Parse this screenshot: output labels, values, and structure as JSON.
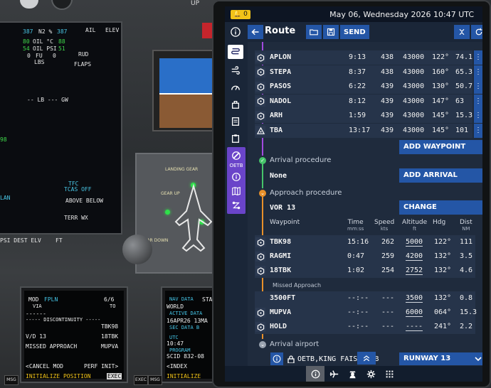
{
  "cockpit": {
    "up_label": "UP",
    "eicas": {
      "n2_left": "387",
      "n2_label": "N2 %",
      "n2_right": "387",
      "oil_temp_label": "OIL °C",
      "oil_temp_left": "80",
      "oil_temp_right": "88",
      "oil_psi_label": "OIL PSI",
      "oil_psi_left": "54",
      "oil_psi_right": "51",
      "fu_label": "FU",
      "fu_left": "0",
      "fu_right": "0",
      "lbs_label": "LBS",
      "ail_label": "AIL",
      "elev_label": "ELEV",
      "rud_label": "RUD",
      "flaps_label": "FLAPS",
      "lb_gw": "-- LB --- GW",
      "tfc": "TFC",
      "tcas_off": "TCAS OFF",
      "above_below": "ABOVE BELOW",
      "terr_wx": "TERR WX",
      "lan": "LAN",
      "psi_dest": "PSI DEST ELV",
      "ft": "FT",
      "num98": "98"
    },
    "gear_panel": {
      "title": "LANDING GEAR",
      "gear_up": "GEAR UP",
      "gear_down": "GEAR DOWN"
    },
    "cdu_left": {
      "line1a": "MOD",
      "line1b": "FPLN",
      "line1c": "6/6",
      "line2a": "VIA",
      "line2b": "TO",
      "line3": "------",
      "line4": "----- DISCONTINUITY -----",
      "line4b": "TBK98",
      "line5a": "V/D 13",
      "line5b": "18TBK",
      "line6a": "MISSED APPROACH",
      "line6b": "MUPVA",
      "line7a": "<CANCEL MOD",
      "line7b": "PERF INIT>",
      "line8a": "INITIALIZE POSITION",
      "line8b": "EXEC"
    },
    "cdu_right": {
      "l1": "NAV DATA",
      "l2": "WORLD",
      "l3": "ACTIVE DATA",
      "l4": "16APR26 13MA",
      "l5": "SEC DATA B",
      "l6": "UTC",
      "l7": "10:47",
      "l8": "PROGRAM",
      "l9": "SCID 832-08",
      "l10": "<INDEX",
      "l11": "INITIALIZE",
      "sta": "STA"
    },
    "msg_label": "MSG",
    "exec_label": "EXEC"
  },
  "efb": {
    "status": {
      "alert_count": "0",
      "datetime": "May 06, Wednesday 2026 10:47 UTC"
    },
    "header": {
      "title": "Route",
      "send_label": "SEND"
    },
    "rail": {
      "oetb_label": "OETB"
    },
    "waypoints": [
      {
        "name": "APLON",
        "time": "9:13",
        "speed": "438",
        "alt": "43000",
        "hdg": "122°",
        "dist": "74.1",
        "more": "⋮"
      },
      {
        "name": "STEPA",
        "time": "8:37",
        "speed": "438",
        "alt": "43000",
        "hdg": "160°",
        "dist": "65.3",
        "more": "⋮"
      },
      {
        "name": "PASOS",
        "time": "6:22",
        "speed": "439",
        "alt": "43000",
        "hdg": "130°",
        "dist": "50.7",
        "more": "⋮"
      },
      {
        "name": "NADOL",
        "time": "8:12",
        "speed": "439",
        "alt": "43000",
        "hdg": "147°",
        "dist": "63",
        "more": "⋮"
      },
      {
        "name": "ARH",
        "time": "1:59",
        "speed": "439",
        "alt": "43000",
        "hdg": "145°",
        "dist": "15.3",
        "more": "⋮"
      },
      {
        "name": "TBA",
        "time": "13:17",
        "speed": "439",
        "alt": "43000",
        "hdg": "145°",
        "dist": "101",
        "more": "⋮"
      }
    ],
    "add_waypoint_label": "ADD WAYPOINT",
    "arrival": {
      "label": "Arrival procedure",
      "value": "None",
      "button": "ADD ARRIVAL"
    },
    "approach": {
      "label": "Approach procedure",
      "value": "VOR 13",
      "button": "CHANGE",
      "columns": {
        "waypoint": "Waypoint",
        "time": "Time",
        "time_unit": "mm:ss",
        "speed": "Speed",
        "speed_unit": "kts",
        "altitude": "Altitude",
        "altitude_unit": "ft",
        "hdg": "Hdg",
        "dist": "Dist",
        "dist_unit": "NM"
      },
      "rows": [
        {
          "name": "TBK98",
          "time": "15:16",
          "speed": "262",
          "alt": "5000",
          "hdg": "122°",
          "dist": "111"
        },
        {
          "name": "RAGMI",
          "time": "0:47",
          "speed": "259",
          "alt": "4200",
          "hdg": "132°",
          "dist": "3.5"
        },
        {
          "name": "18TBK",
          "time": "1:02",
          "speed": "254",
          "alt": "2752",
          "hdg": "132°",
          "dist": "4.6"
        }
      ],
      "missed_label": "Missed Approach",
      "missed_rows": [
        {
          "name": "3500FT",
          "time": "--:--",
          "speed": "---",
          "alt": "3500",
          "hdg": "132°",
          "dist": "0.8"
        },
        {
          "name": "MUPVA",
          "time": "--:--",
          "speed": "---",
          "alt": "6000",
          "hdg": "064°",
          "dist": "15.3"
        },
        {
          "name": "HOLD",
          "time": "--:--",
          "speed": "---",
          "alt": "----",
          "hdg": "241°",
          "dist": "2.2"
        }
      ]
    },
    "arrival_airport": {
      "label": "Arrival airport",
      "value": "OETB,KING FAISAL AB",
      "runway_button": "RUNWAY 13"
    }
  }
}
